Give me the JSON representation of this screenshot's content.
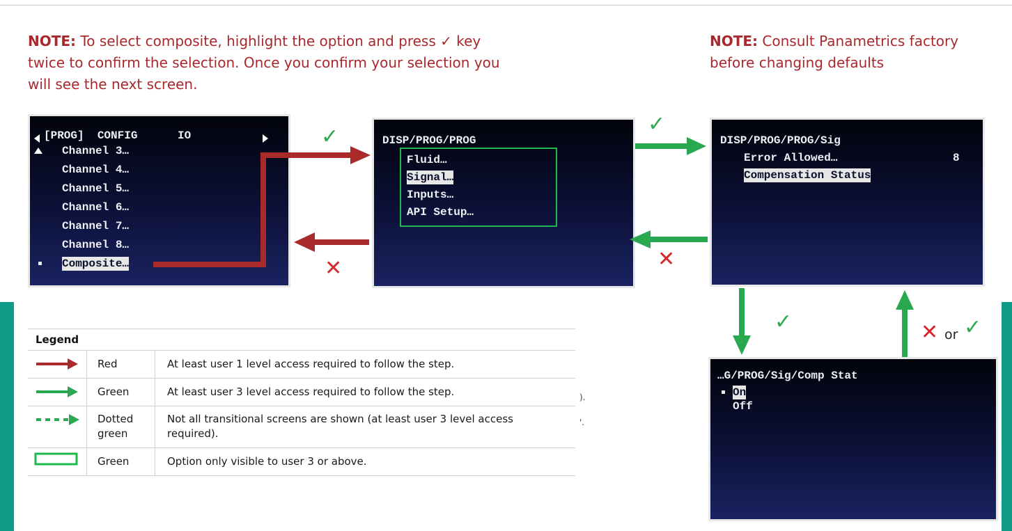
{
  "notes": {
    "left": {
      "label": "NOTE:",
      "text": " To select composite, highlight the option and press ✓ key twice to confirm the selection. Once you confirm your selection you will see the next screen."
    },
    "right": {
      "label": "NOTE:",
      "text": " Consult Panametrics factory before changing defaults"
    }
  },
  "screen_config": {
    "header": "[PROG]  CONFIG      IO",
    "items": [
      "Channel 3…",
      "Channel 4…",
      "Channel 5…",
      "Channel 6…",
      "Channel 7…",
      "Channel 8…",
      "Composite…"
    ],
    "selected_index": 6
  },
  "screen_prog": {
    "header": "DISP/PROG/PROG",
    "items": [
      "Fluid…",
      "Signal…",
      "Inputs…",
      "API Setup…"
    ],
    "selected_index": 1
  },
  "screen_sig": {
    "header": "DISP/PROG/PROG/Sig",
    "items": [
      {
        "label": "Error Allowed…",
        "value": "8"
      },
      {
        "label": "Compensation Status",
        "value": ""
      }
    ],
    "selected_index": 1
  },
  "screen_comp": {
    "header": "…G/PROG/Sig/Comp Stat",
    "items": [
      "On",
      "Off"
    ],
    "selected_index": 0
  },
  "marks": {
    "check": "✓",
    "cross": "✕",
    "or": "or"
  },
  "colors": {
    "red": "#a82a2a",
    "green": "#2aa84f",
    "teal": "#0f9c86",
    "note_red": "#a8282c"
  },
  "legend": {
    "title": "Legend",
    "rows": [
      {
        "symbol": "red-solid-arrow",
        "name": "Red",
        "description": "At least user 1 level access required to follow the step."
      },
      {
        "symbol": "green-solid-arrow",
        "name": "Green",
        "description": "At least user 3 level access required to follow the step."
      },
      {
        "symbol": "green-dotted-arrow",
        "name": "Dotted green",
        "description": "Not all transitional screens are shown (at least user 3 level access required)."
      },
      {
        "symbol": "green-box",
        "name": "Green",
        "description": "Option only visible to user 3 or above."
      }
    ]
  },
  "stray_marks": [
    ").",
    "'."
  ]
}
